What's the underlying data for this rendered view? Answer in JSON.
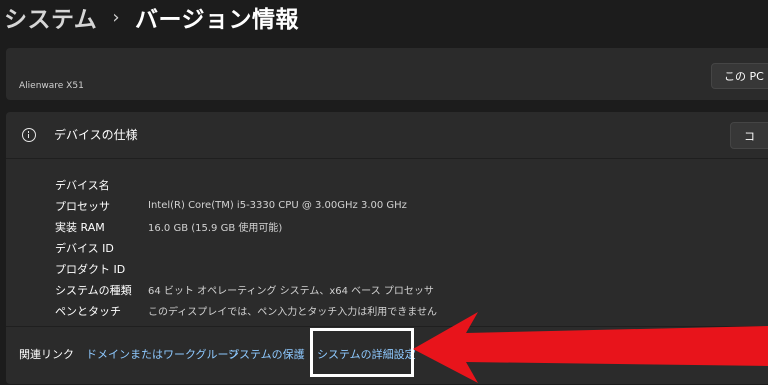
{
  "breadcrumb": {
    "parent": "システム",
    "separator": "›",
    "current": "バージョン情報"
  },
  "device_card": {
    "device_name": "Alienware X51",
    "rename_button": "この PC の"
  },
  "specs": {
    "title": "デバイスの仕様",
    "copy_button": "コ",
    "rows": [
      {
        "label": "デバイス名",
        "value": ""
      },
      {
        "label": "プロセッサ",
        "value": "Intel(R) Core(TM) i5-3330 CPU @ 3.00GHz   3.00 GHz"
      },
      {
        "label": "実装 RAM",
        "value": "16.0 GB (15.9 GB 使用可能)"
      },
      {
        "label": "デバイス ID",
        "value": ""
      },
      {
        "label": "プロダクト ID",
        "value": ""
      },
      {
        "label": "システムの種類",
        "value": "64 ビット オペレーティング システム、x64 ベース プロセッサ"
      },
      {
        "label": "ペンとタッチ",
        "value": "このディスプレイでは、ペン入力とタッチ入力は利用できません"
      }
    ]
  },
  "related": {
    "label": "関連リンク",
    "links": [
      "ドメインまたはワークグループ",
      "システムの保護",
      "システムの詳細設定"
    ]
  },
  "annotation": {
    "arrow_color": "#e8141b",
    "box_color": "#ffffff",
    "arrow_icon": "red-pointer-arrow"
  }
}
